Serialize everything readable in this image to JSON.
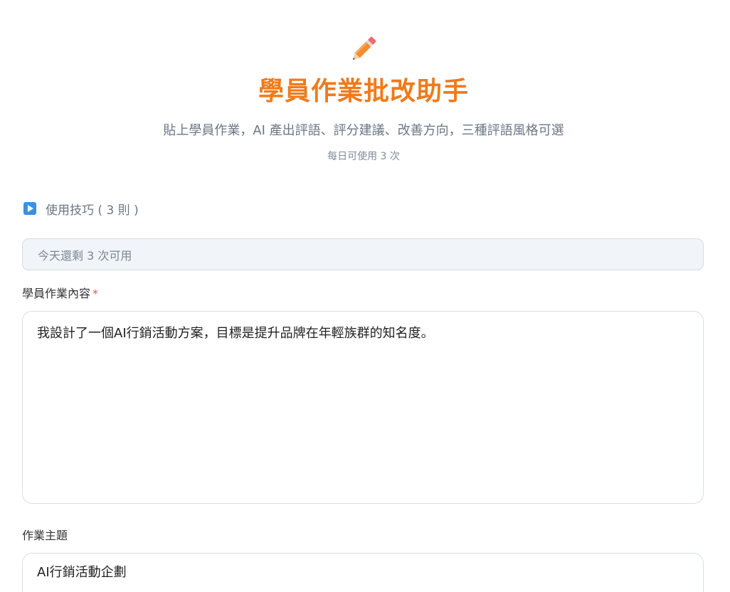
{
  "header": {
    "icon": "pencil-icon",
    "title": "學員作業批改助手",
    "subtitle": "貼上學員作業，AI 產出評語、評分建議、改善方向，三種評語風格可選",
    "usage_limit": "每日可使用 3 次"
  },
  "tips": {
    "icon": "play-triangle-icon",
    "label": "使用技巧 ( 3 則 )"
  },
  "quota": {
    "remaining_text": "今天還剩 3 次可用"
  },
  "form": {
    "homework": {
      "label": "學員作業內容",
      "required_mark": "*",
      "value": "我設計了一個AI行銷活動方案，目標是提升品牌在年輕族群的知名度。"
    },
    "topic": {
      "label": "作業主題",
      "value": "AI行銷活動企劃"
    }
  },
  "colors": {
    "accent": "#ee7b1d",
    "required": "#e05a4a",
    "info_blue": "#3d8fe0"
  }
}
